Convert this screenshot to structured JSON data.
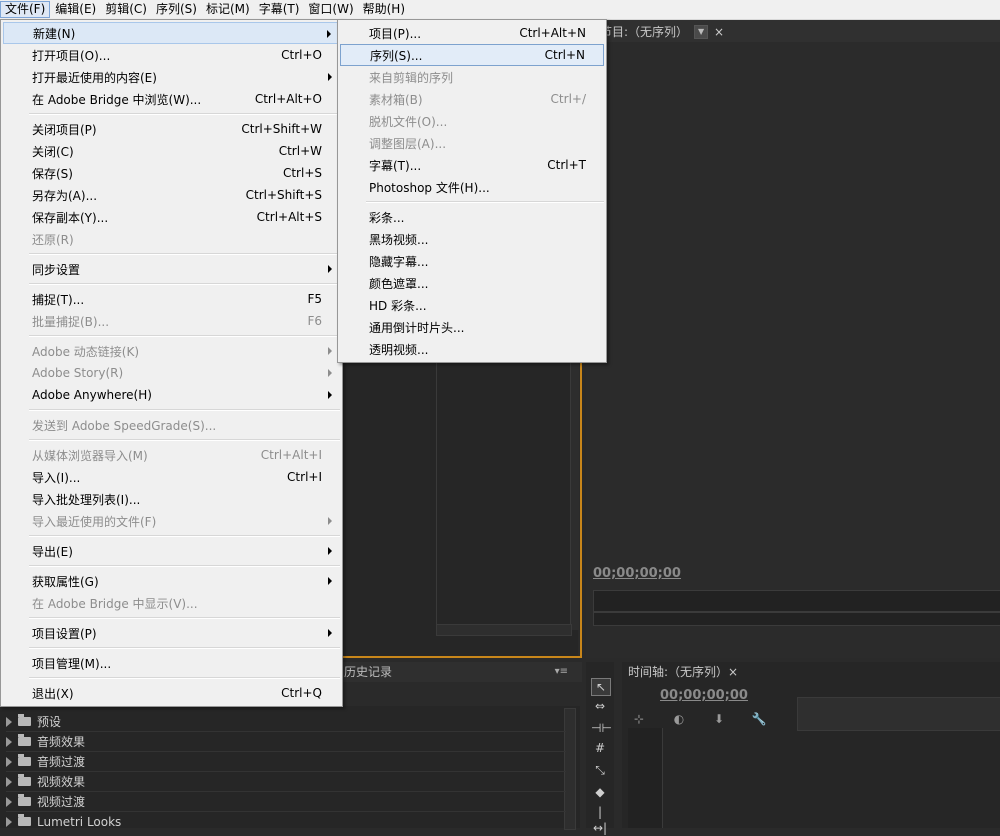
{
  "menubar": [
    {
      "label": "文件(F)",
      "active": true
    },
    {
      "label": "编辑(E)"
    },
    {
      "label": "剪辑(C)"
    },
    {
      "label": "序列(S)"
    },
    {
      "label": "标记(M)"
    },
    {
      "label": "字幕(T)"
    },
    {
      "label": "窗口(W)"
    },
    {
      "label": "帮助(H)"
    }
  ],
  "file_menu": [
    {
      "label": "新建(N)",
      "shortcut": "",
      "submenu": true,
      "highlight": true
    },
    {
      "label": "打开项目(O)...",
      "shortcut": "Ctrl+O"
    },
    {
      "label": "打开最近使用的内容(E)",
      "shortcut": "",
      "submenu": true
    },
    {
      "label": "在 Adobe Bridge 中浏览(W)...",
      "shortcut": "Ctrl+Alt+O"
    },
    {
      "sep": true
    },
    {
      "label": "关闭项目(P)",
      "shortcut": "Ctrl+Shift+W"
    },
    {
      "label": "关闭(C)",
      "shortcut": "Ctrl+W"
    },
    {
      "label": "保存(S)",
      "shortcut": "Ctrl+S"
    },
    {
      "label": "另存为(A)...",
      "shortcut": "Ctrl+Shift+S"
    },
    {
      "label": "保存副本(Y)...",
      "shortcut": "Ctrl+Alt+S"
    },
    {
      "label": "还原(R)",
      "shortcut": "",
      "disabled": true
    },
    {
      "sep": true
    },
    {
      "label": "同步设置",
      "shortcut": "",
      "submenu": true
    },
    {
      "sep": true
    },
    {
      "label": "捕捉(T)...",
      "shortcut": "F5"
    },
    {
      "label": "批量捕捉(B)...",
      "shortcut": "F6",
      "disabled": true
    },
    {
      "sep": true
    },
    {
      "label": "Adobe 动态链接(K)",
      "shortcut": "",
      "submenu": true,
      "disabled": true
    },
    {
      "label": "Adobe Story(R)",
      "shortcut": "",
      "submenu": true,
      "disabled": true
    },
    {
      "label": "Adobe Anywhere(H)",
      "shortcut": "",
      "submenu": true
    },
    {
      "sep": true
    },
    {
      "label": "发送到 Adobe SpeedGrade(S)...",
      "shortcut": "",
      "disabled": true
    },
    {
      "sep": true
    },
    {
      "label": "从媒体浏览器导入(M)",
      "shortcut": "Ctrl+Alt+I",
      "disabled": true
    },
    {
      "label": "导入(I)...",
      "shortcut": "Ctrl+I"
    },
    {
      "label": "导入批处理列表(I)...",
      "shortcut": ""
    },
    {
      "label": "导入最近使用的文件(F)",
      "shortcut": "",
      "submenu": true,
      "disabled": true
    },
    {
      "sep": true
    },
    {
      "label": "导出(E)",
      "shortcut": "",
      "submenu": true
    },
    {
      "sep": true
    },
    {
      "label": "获取属性(G)",
      "shortcut": "",
      "submenu": true
    },
    {
      "label": "在 Adobe Bridge 中显示(V)...",
      "shortcut": "",
      "disabled": true
    },
    {
      "sep": true
    },
    {
      "label": "项目设置(P)",
      "shortcut": "",
      "submenu": true
    },
    {
      "sep": true
    },
    {
      "label": "项目管理(M)...",
      "shortcut": ""
    },
    {
      "sep": true
    },
    {
      "label": "退出(X)",
      "shortcut": "Ctrl+Q"
    }
  ],
  "new_submenu": [
    {
      "label": "项目(P)...",
      "shortcut": "Ctrl+Alt+N"
    },
    {
      "label": "序列(S)...",
      "shortcut": "Ctrl+N",
      "highlight": true
    },
    {
      "label": "来自剪辑的序列",
      "shortcut": "",
      "disabled": true
    },
    {
      "label": "素材箱(B)",
      "shortcut": "Ctrl+/",
      "disabled": true
    },
    {
      "label": "脱机文件(O)...",
      "shortcut": "",
      "disabled": true
    },
    {
      "label": "调整图层(A)...",
      "shortcut": "",
      "disabled": true
    },
    {
      "label": "字幕(T)...",
      "shortcut": "Ctrl+T"
    },
    {
      "label": "Photoshop 文件(H)...",
      "shortcut": ""
    },
    {
      "sep": true
    },
    {
      "label": "彩条...",
      "shortcut": ""
    },
    {
      "label": "黑场视频...",
      "shortcut": ""
    },
    {
      "label": "隐藏字幕...",
      "shortcut": ""
    },
    {
      "label": "颜色遮罩...",
      "shortcut": ""
    },
    {
      "label": "HD 彩条...",
      "shortcut": ""
    },
    {
      "label": "通用倒计时片头...",
      "shortcut": ""
    },
    {
      "label": "透明视频...",
      "shortcut": ""
    }
  ],
  "program_monitor": {
    "tab_label": "节目:（无序列）",
    "close": "×",
    "timecode": "00;00;00;00"
  },
  "history_panel": {
    "tab_label": "历史记录",
    "menu_icon": "▾≡"
  },
  "effects_panel": {
    "items": [
      "预设",
      "音频效果",
      "音频过渡",
      "视频效果",
      "视频过渡",
      "Lumetri Looks"
    ]
  },
  "timeline": {
    "tab_label": "时间轴:（无序列）×",
    "timecode": "00;00;00;00"
  },
  "colors": {
    "accent_orange": "#c8861a",
    "menu_bg": "#f0f0f0",
    "highlight": "#dce8f6"
  }
}
